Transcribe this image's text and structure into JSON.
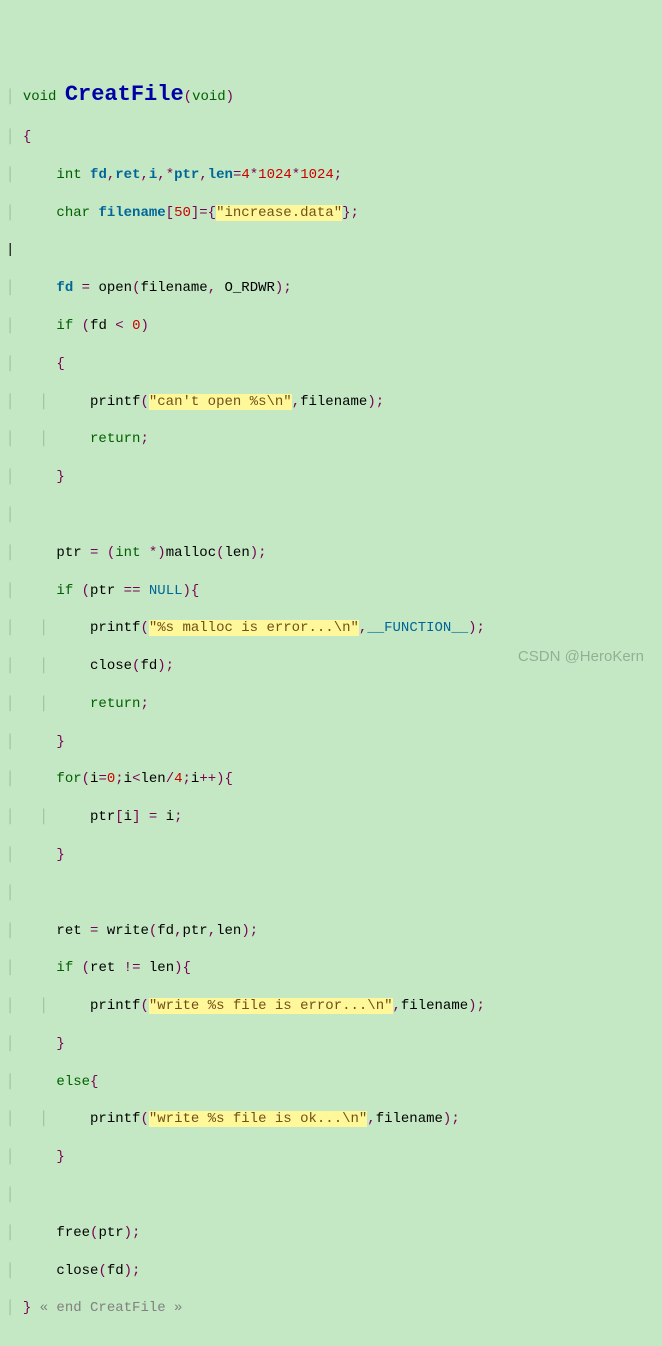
{
  "sig": {
    "ret": "void",
    "name": "CreatFile",
    "arg": "void"
  },
  "decl1": {
    "t": "int",
    "v1": "fd",
    "v2": "ret",
    "v3": "i",
    "v4": "ptr",
    "v5": "len",
    "n1": "4",
    "n2": "1024",
    "n3": "1024"
  },
  "decl2": {
    "t": "char",
    "v": "filename",
    "size": "50",
    "s": "\"increase.data\""
  },
  "open": {
    "call": "open",
    "a1": "filename",
    "a2": "O_RDWR"
  },
  "if1": {
    "kw": "if",
    "v": "fd",
    "n": "0"
  },
  "p1": {
    "call": "printf",
    "s": "\"can't open %s\\n\"",
    "a": "filename"
  },
  "ret": "return",
  "malloc": {
    "v": "ptr",
    "t": "int",
    "call": "malloc",
    "a": "len"
  },
  "if2": {
    "kw": "if",
    "v": "ptr",
    "null": "NULL"
  },
  "p2": {
    "call": "printf",
    "s": "\"%s malloc is error...\\n\"",
    "a": "__FUNCTION__"
  },
  "close": {
    "call": "close",
    "a": "fd"
  },
  "for": {
    "kw": "for",
    "v": "i",
    "n0": "0",
    "v2": "len",
    "n4": "4"
  },
  "forBody": {
    "a": "ptr",
    "i": "i"
  },
  "write": {
    "v": "ret",
    "call": "write",
    "a1": "fd",
    "a2": "ptr",
    "a3": "len"
  },
  "if3": {
    "kw": "if",
    "v1": "ret",
    "v2": "len"
  },
  "p3": {
    "call": "printf",
    "s": "\"write %s file is error...\\n\"",
    "a": "filename"
  },
  "else": "else",
  "p4": {
    "call": "printf",
    "s": "\"write %s file is ok...\\n\"",
    "a": "filename"
  },
  "free": {
    "call": "free",
    "a": "ptr"
  },
  "closeEnd": {
    "call": "close",
    "a": "fd"
  },
  "endComment": "« end CreatFile »",
  "watermark": "CSDN @HeroKern"
}
